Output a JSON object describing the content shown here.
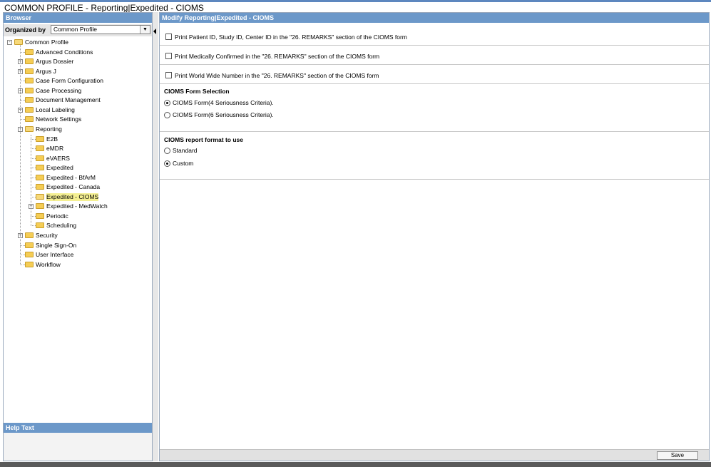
{
  "page": {
    "title": "COMMON PROFILE - Reporting|Expedited - CIOMS"
  },
  "browser": {
    "header": "Browser",
    "organized_by_label": "Organized by",
    "organized_by_value": "Common Profile",
    "tree": [
      {
        "label": "Common Profile",
        "level": 0,
        "expander": "minus",
        "open": true
      },
      {
        "label": "Advanced Conditions",
        "level": 1
      },
      {
        "label": "Argus Dossier",
        "level": 1,
        "expander": "plus"
      },
      {
        "label": "Argus J",
        "level": 1,
        "expander": "plus"
      },
      {
        "label": "Case Form Configuration",
        "level": 1
      },
      {
        "label": "Case Processing",
        "level": 1,
        "expander": "plus"
      },
      {
        "label": "Document Management",
        "level": 1
      },
      {
        "label": "Local Labeling",
        "level": 1,
        "expander": "plus"
      },
      {
        "label": "Network Settings",
        "level": 1
      },
      {
        "label": "Reporting",
        "level": 1,
        "expander": "minus",
        "open": true
      },
      {
        "label": "E2B",
        "level": 2
      },
      {
        "label": "eMDR",
        "level": 2
      },
      {
        "label": "eVAERS",
        "level": 2
      },
      {
        "label": "Expedited",
        "level": 2
      },
      {
        "label": "Expedited - BfArM",
        "level": 2
      },
      {
        "label": "Expedited - Canada",
        "level": 2
      },
      {
        "label": "Expedited - CIOMS",
        "level": 2,
        "selected": true,
        "open": true
      },
      {
        "label": "Expedited - MedWatch",
        "level": 2,
        "expander": "plus"
      },
      {
        "label": "Periodic",
        "level": 2
      },
      {
        "label": "Scheduling",
        "level": 2
      },
      {
        "label": "Security",
        "level": 1,
        "expander": "plus"
      },
      {
        "label": "Single Sign-On",
        "level": 1
      },
      {
        "label": "User Interface",
        "level": 1
      },
      {
        "label": "Workflow",
        "level": 1
      }
    ]
  },
  "help": {
    "header": "Help Text"
  },
  "main": {
    "header": "Modify Reporting|Expedited - CIOMS",
    "options": [
      {
        "label": "Print Patient ID, Study ID, Center ID in the \"26. REMARKS\" section of the CIOMS form",
        "checked": false
      },
      {
        "label": "Print Medically Confirmed in the \"26. REMARKS\" section of the CIOMS form",
        "checked": false
      },
      {
        "label": "Print World Wide Number in the \"26. REMARKS\" section of the CIOMS form",
        "checked": false
      }
    ],
    "form_selection": {
      "title": "CIOMS Form Selection",
      "choices": [
        {
          "label": "CIOMS Form(4 Seriousness Criteria).",
          "selected": true
        },
        {
          "label": "CIOMS Form(6 Seriousness Criteria).",
          "selected": false
        }
      ]
    },
    "report_format": {
      "title": "CIOMS report format to use",
      "choices": [
        {
          "label": "Standard",
          "selected": false
        },
        {
          "label": "Custom",
          "selected": true
        }
      ]
    },
    "save_label": "Save"
  }
}
